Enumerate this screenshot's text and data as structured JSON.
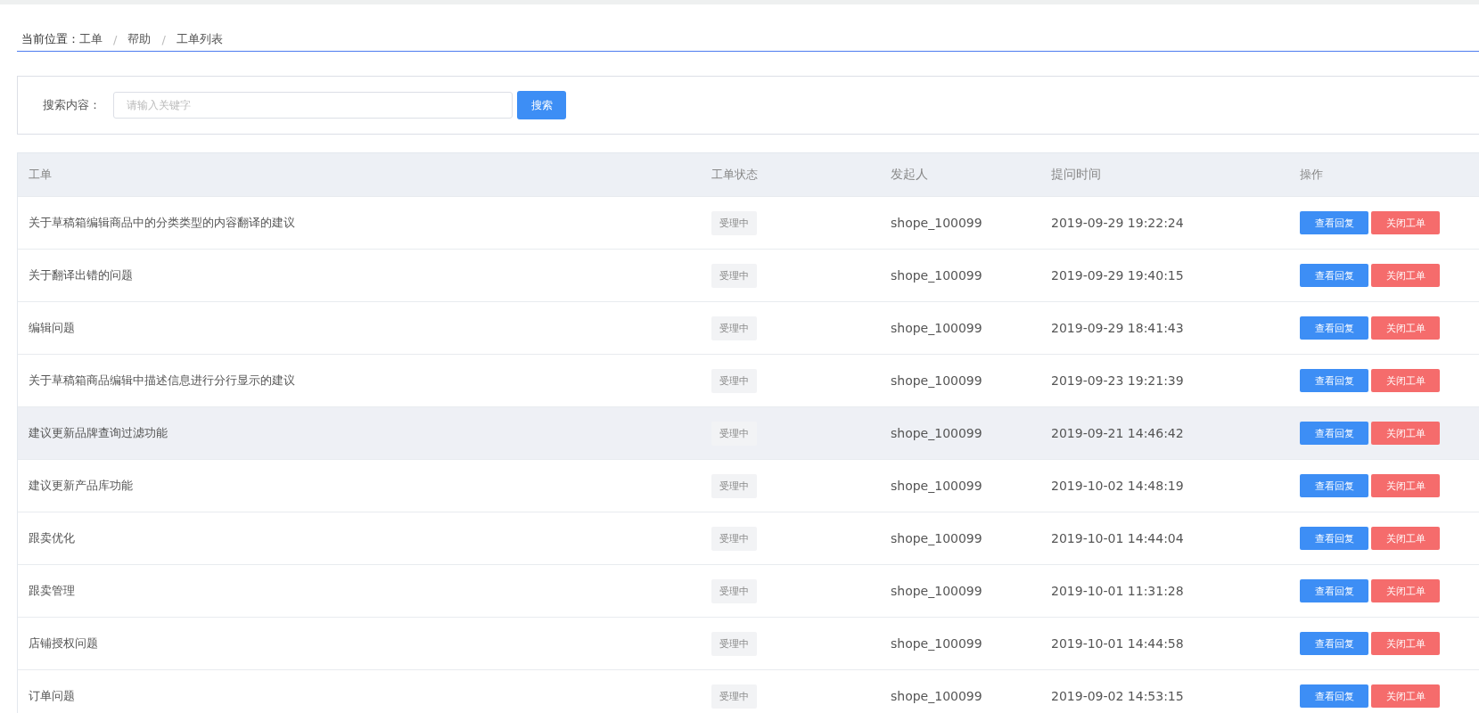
{
  "breadcrumb": {
    "label": "当前位置：",
    "separator": "/",
    "items": [
      "工单",
      "帮助",
      "工单列表"
    ]
  },
  "search": {
    "label": "搜索内容：",
    "placeholder": "请输入关键字",
    "button": "搜索"
  },
  "table": {
    "columns": [
      "工单",
      "工单状态",
      "发起人",
      "提问时间",
      "操作"
    ],
    "rows": [
      {
        "title": "关于草稿箱编辑商品中的分类类型的内容翻译的建议",
        "status": "受理中",
        "creator": "shope_100099",
        "time": "2019-09-29 19:22:24",
        "actions": [
          "查看回复",
          "关闭工单"
        ],
        "highlighted": false
      },
      {
        "title": "关于翻译出错的问题",
        "status": "受理中",
        "creator": "shope_100099",
        "time": "2019-09-29 19:40:15",
        "actions": [
          "查看回复",
          "关闭工单"
        ],
        "highlighted": false
      },
      {
        "title": "编辑问题",
        "status": "受理中",
        "creator": "shope_100099",
        "time": "2019-09-29 18:41:43",
        "actions": [
          "查看回复",
          "关闭工单"
        ],
        "highlighted": false
      },
      {
        "title": "关于草稿箱商品编辑中描述信息进行分行显示的建议",
        "status": "受理中",
        "creator": "shope_100099",
        "time": "2019-09-23 19:21:39",
        "actions": [
          "查看回复",
          "关闭工单"
        ],
        "highlighted": false
      },
      {
        "title": "建议更新品牌查询过滤功能",
        "status": "受理中",
        "creator": "shope_100099",
        "time": "2019-09-21 14:46:42",
        "actions": [
          "查看回复",
          "关闭工单"
        ],
        "highlighted": true
      },
      {
        "title": "建议更新产品库功能",
        "status": "受理中",
        "creator": "shope_100099",
        "time": "2019-10-02 14:48:19",
        "actions": [
          "查看回复",
          "关闭工单"
        ],
        "highlighted": false
      },
      {
        "title": "跟卖优化",
        "status": "受理中",
        "creator": "shope_100099",
        "time": "2019-10-01 14:44:04",
        "actions": [
          "查看回复",
          "关闭工单"
        ],
        "highlighted": false
      },
      {
        "title": "跟卖管理",
        "status": "受理中",
        "creator": "shope_100099",
        "time": "2019-10-01 11:31:28",
        "actions": [
          "查看回复",
          "关闭工单"
        ],
        "highlighted": false
      },
      {
        "title": "店铺授权问题",
        "status": "受理中",
        "creator": "shope_100099",
        "time": "2019-10-01 14:44:58",
        "actions": [
          "查看回复",
          "关闭工单"
        ],
        "highlighted": false
      },
      {
        "title": "订单问题",
        "status": "受理中",
        "creator": "shope_100099",
        "time": "2019-09-02 14:53:15",
        "actions": [
          "查看回复",
          "关闭工单"
        ],
        "highlighted": false
      }
    ]
  }
}
